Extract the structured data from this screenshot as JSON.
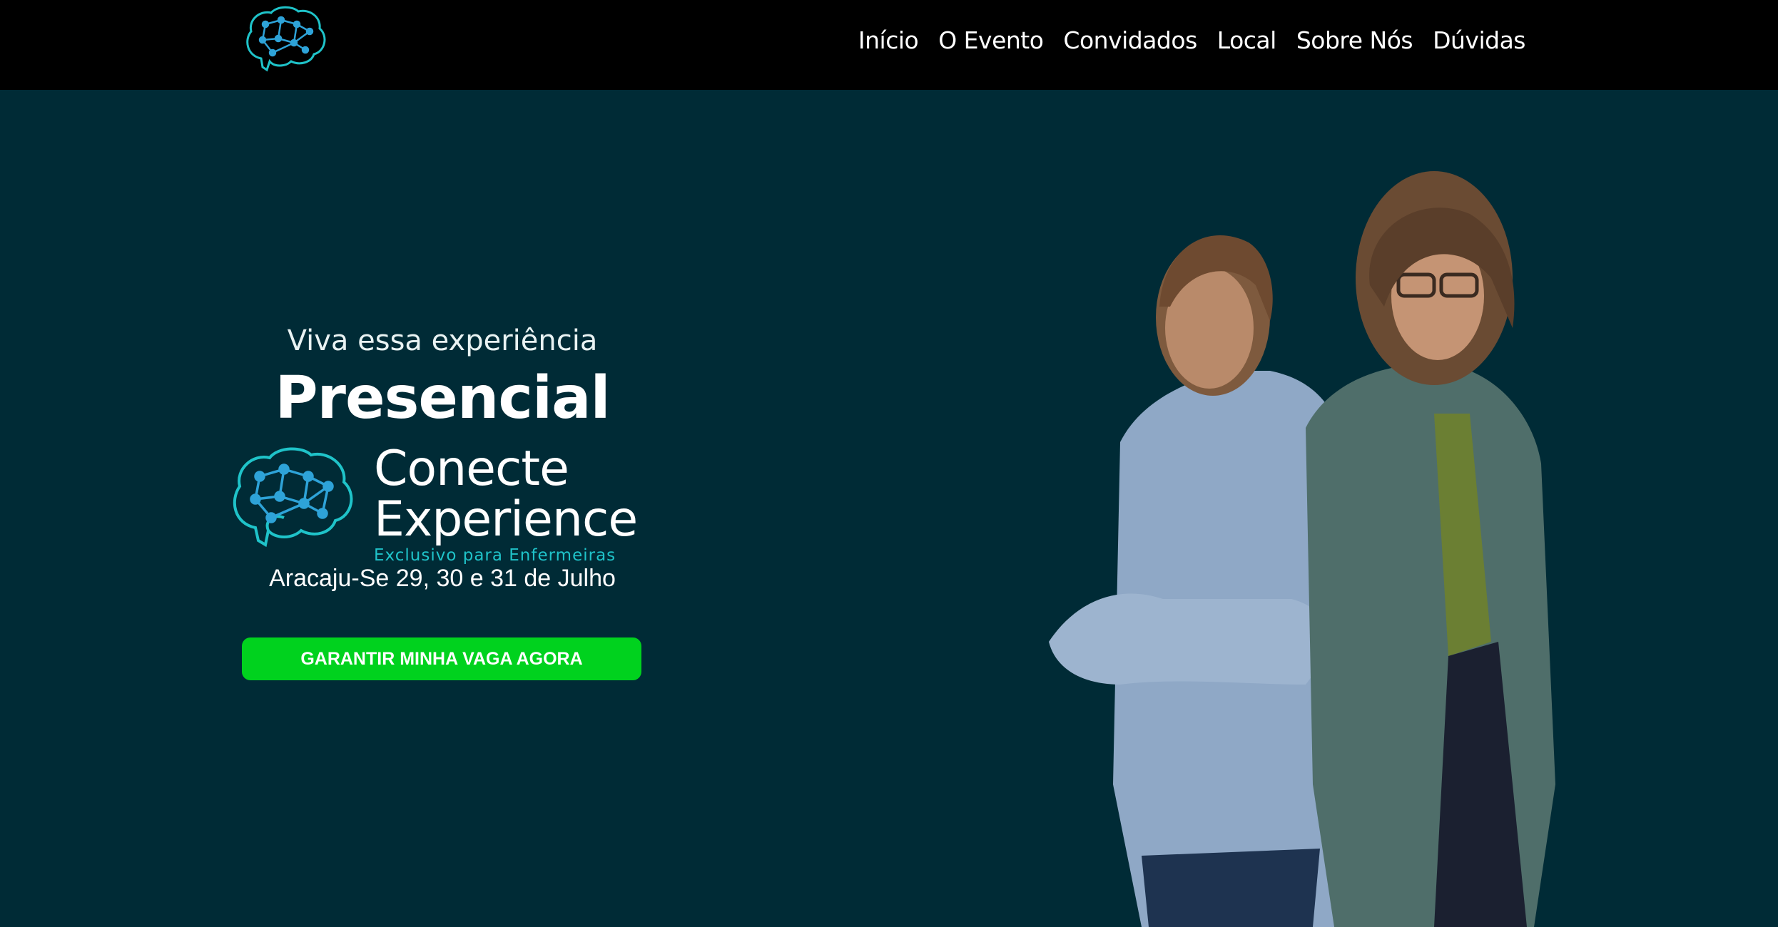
{
  "header": {
    "logo_icon": "brain-network-icon",
    "nav": [
      {
        "label": "Início"
      },
      {
        "label": "O Evento"
      },
      {
        "label": "Convidados"
      },
      {
        "label": "Local"
      },
      {
        "label": "Sobre Nós"
      },
      {
        "label": "Dúvidas"
      }
    ]
  },
  "hero": {
    "tagline": "Viva essa experiência",
    "headline": "Presencial",
    "brand": {
      "line1": "Conecte",
      "line2": "Experience",
      "tag": "Exclusivo para Enfermeiras",
      "icon": "brain-network-icon"
    },
    "date_location": "Aracaju-Se 29, 30 e 31 de Julho",
    "cta_label": "GARANTIR MINHA VAGA AGORA",
    "photo": "two-women-hosts-photo"
  },
  "colors": {
    "background": "#002b36",
    "header": "#000000",
    "accent_cyan": "#1fc3c9",
    "cta_green": "#00d21e"
  }
}
